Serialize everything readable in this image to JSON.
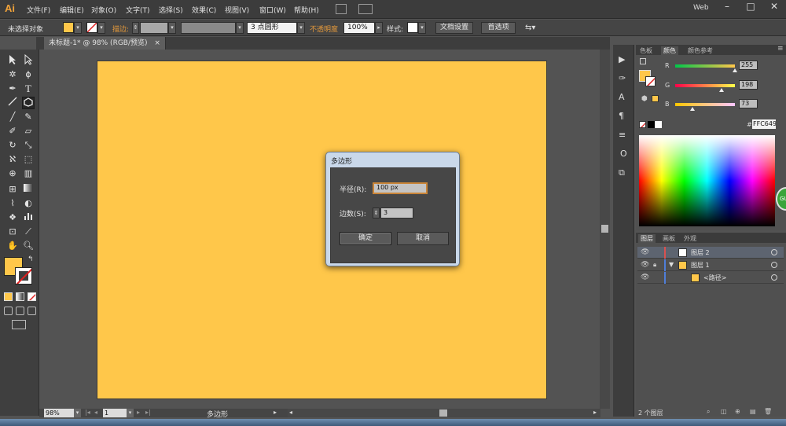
{
  "app": {
    "logo": "Ai"
  },
  "menu": {
    "items": [
      "文件(F)",
      "编辑(E)",
      "对象(O)",
      "文字(T)",
      "选择(S)",
      "效果(C)",
      "视图(V)",
      "窗口(W)",
      "帮助(H)"
    ],
    "workspace": "Web",
    "window_controls": [
      "–",
      "□",
      "✕"
    ]
  },
  "controlbar": {
    "selection_status": "未选择对象",
    "stroke_label": "描边:",
    "stroke_style": "3 点圆形",
    "opacity_label": "不透明度",
    "opacity_value": "100%",
    "style_label": "样式:",
    "doc_setup": "文档设置",
    "preferences": "首选项",
    "fill_color": "#ffc74a"
  },
  "document": {
    "tab_title": "未标题-1* @ 98% (RGB/预览)",
    "tab_close": "×",
    "artboard_color": "#ffc74a"
  },
  "status": {
    "zoom": "98%",
    "page": "1",
    "current_tool": "多边形"
  },
  "tools": {
    "icons": [
      "selection-tool",
      "direct-selection-tool",
      "magic-wand-tool",
      "lasso-tool",
      "pen-tool",
      "type-tool",
      "line-tool",
      "polygon-tool",
      "paintbrush-tool",
      "pencil-tool",
      "blob-brush-tool",
      "eraser-tool",
      "rotate-tool",
      "scale-tool",
      "width-tool",
      "free-transform-tool",
      "shape-builder-tool",
      "perspective-grid-tool",
      "mesh-tool",
      "gradient-tool",
      "eyedropper-tool",
      "blend-tool",
      "symbol-sprayer-tool",
      "column-graph-tool",
      "artboard-tool",
      "slice-tool",
      "hand-tool",
      "zoom-tool"
    ]
  },
  "color_panel": {
    "tabs": [
      "色板",
      "颜色",
      "颜色参考"
    ],
    "active_tab": "颜色",
    "channels": [
      {
        "label": "R",
        "value": "255",
        "fraction": 1.0
      },
      {
        "label": "G",
        "value": "198",
        "fraction": 0.78
      },
      {
        "label": "B",
        "value": "73",
        "fraction": 0.29
      }
    ],
    "hex_label": "#",
    "hex_value": "FFC649"
  },
  "layers_panel": {
    "tabs": [
      "图层",
      "画板",
      "外观"
    ],
    "rows": [
      {
        "name": "图层 2",
        "color": "#d9514f"
      },
      {
        "name": "图层 1",
        "color": "#4f7ed9"
      },
      {
        "name": "<路径>",
        "color": "#4f7ed9"
      }
    ],
    "footer": "2 个图层"
  },
  "dialog": {
    "title": "多边形",
    "radius_label": "半径(R):",
    "radius_value": "100 px",
    "sides_label": "边数(S):",
    "sides_value": "3",
    "ok": "确定",
    "cancel": "取消"
  },
  "side_badge": "GU"
}
